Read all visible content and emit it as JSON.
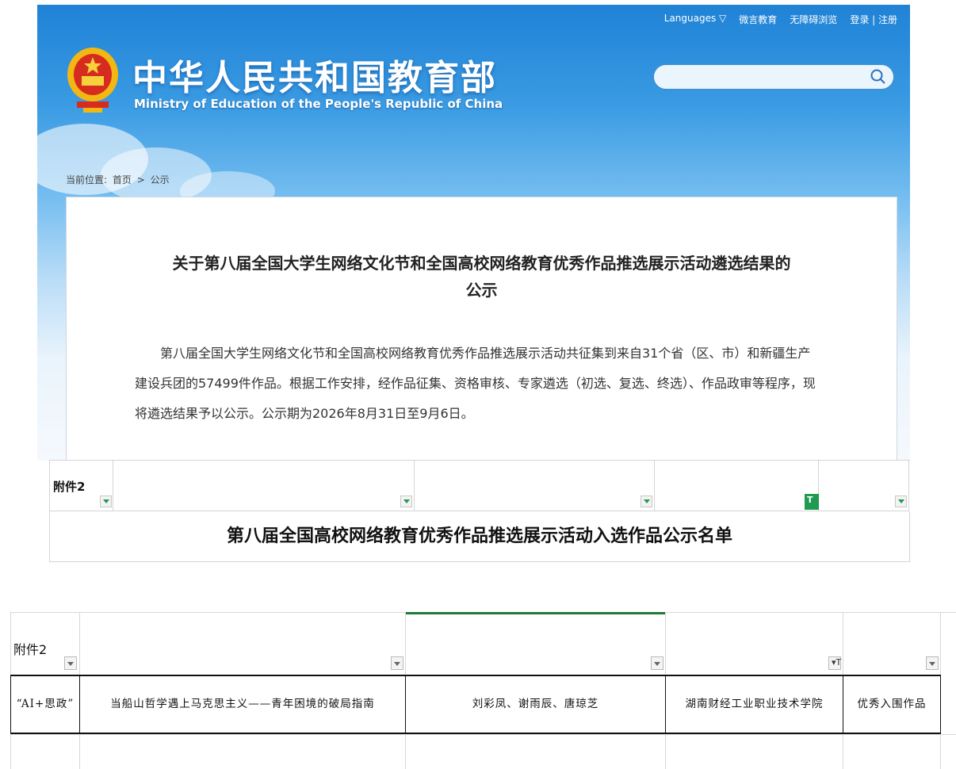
{
  "header": {
    "title_cn": "中华人民共和国教育部",
    "title_en": "Ministry of Education of the People's Republic of China",
    "links": [
      "Languages ▽",
      "微言教育",
      "无障碍浏览",
      "登录 | 注册"
    ],
    "search_placeholder": ""
  },
  "breadcrumb": {
    "prefix": "当前位置:",
    "home": "首页",
    "sep": ">",
    "current": "公示"
  },
  "article": {
    "title_line1": "关于第八届全国大学生网络文化节和全国高校网络教育优秀作品推选展示活动遴选结果的",
    "title_line2": "公示",
    "body": "第八届全国大学生网络文化节和全国高校网络教育优秀作品推选展示活动共征集到来自31个省（区、市）和新疆生产建设兵团的57499件作品。根据工作安排，经作品征集、资格审核、专家遴选（初选、复选、终选）、作品政审等程序，现将遴选结果予以公示。公示期为2026年8月31日至9月6日。"
  },
  "sheet1": {
    "label": "附件2",
    "title": "第八届全国高校网络教育优秀作品推选展示活动入选作品公示名单",
    "filter_glyph": "T"
  },
  "sheet2": {
    "label": "附件2",
    "row": {
      "category": "“AI+思政”",
      "work_title": "当船山哲学遇上马克思主义——青年困境的破局指南",
      "authors": "刘彩凤、谢雨辰、唐琼芝",
      "school": "湖南财经工业职业技术学院",
      "result": "优秀入围作品"
    },
    "filter_glyph": "▾T"
  },
  "colors": {
    "header_blue": "#1f82d6",
    "filter_green": "#1e9b50"
  }
}
